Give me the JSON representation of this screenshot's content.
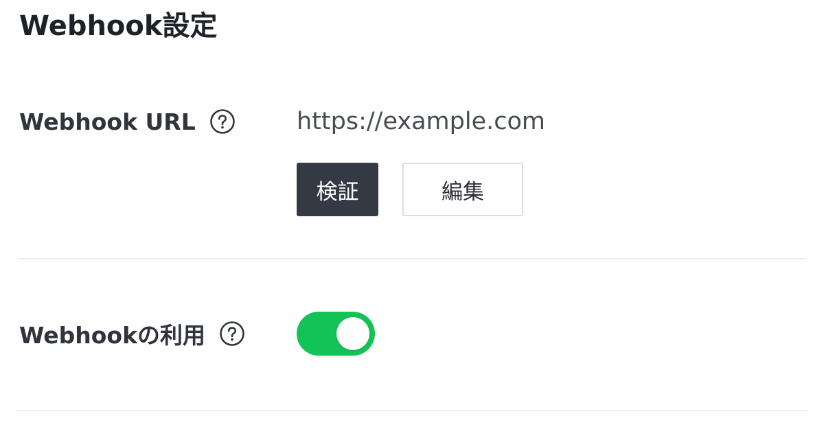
{
  "section": {
    "title": "Webhook設定"
  },
  "webhook_url": {
    "label": "Webhook URL",
    "help_icon": "question-circle-icon",
    "value": "https://example.com",
    "verify_button": "検証",
    "edit_button": "編集"
  },
  "webhook_usage": {
    "label": "Webhookの利用",
    "help_icon": "question-circle-icon",
    "enabled": true,
    "toggle_color": "#14c356"
  },
  "colors": {
    "verify_button_bg": "#343a43",
    "divider": "#eceef0"
  }
}
